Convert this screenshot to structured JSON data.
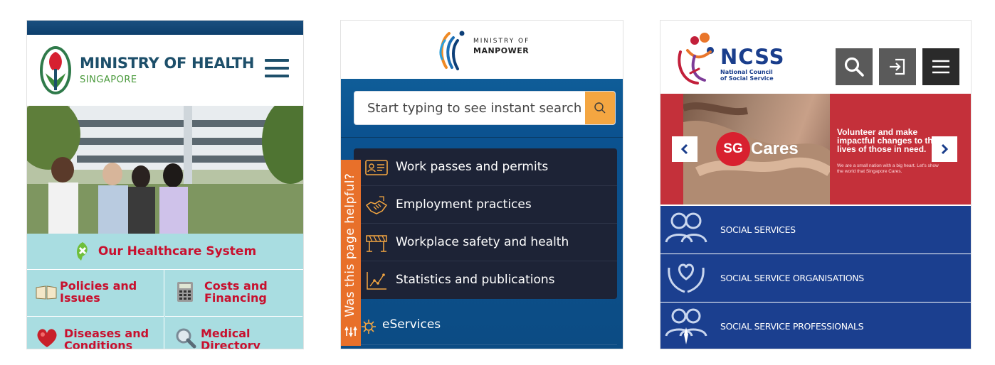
{
  "moh": {
    "title": "MINISTRY OF HEALTH",
    "subtitle": "SINGAPORE",
    "featured_label": "Our Healthcare System",
    "grid": [
      {
        "label1": "Policies and",
        "label2": "Issues",
        "icon": "book-icon"
      },
      {
        "label1": "Costs and",
        "label2": "Financing",
        "icon": "calculator-icon"
      },
      {
        "label1": "Diseases and",
        "label2": "Conditions",
        "icon": "heart-icon"
      },
      {
        "label1": "Medical",
        "label2": "Directory",
        "icon": "magnifier-icon"
      }
    ],
    "colors": {
      "brand": "#1d4f6a",
      "accent": "#c8102e",
      "nav_bg": "#a9dde1"
    }
  },
  "mom": {
    "logo_line1": "MINISTRY OF",
    "logo_line2": "MANPOWER",
    "search_placeholder": "Start typing to see instant search",
    "menu": [
      {
        "label": "Work passes and permits",
        "icon": "id-card-icon"
      },
      {
        "label": "Employment practices",
        "icon": "handshake-icon"
      },
      {
        "label": "Workplace safety and health",
        "icon": "barrier-icon"
      },
      {
        "label": "Statistics and publications",
        "icon": "line-chart-icon"
      }
    ],
    "eservices_label": "eServices",
    "feedback_label": "Was this page helpful?",
    "colors": {
      "header_bg": "#0f5d98",
      "menu_bg": "#1d2336",
      "accent": "#f4a641",
      "feedback": "#e8702a"
    }
  },
  "ncss": {
    "logo_name": "NCSS",
    "logo_full_line1": "National Council",
    "logo_full_line2": "of Social Service",
    "banner": {
      "sg": "SG",
      "cares": "Cares",
      "tagline": "Volunteer and make impactful changes to the lives of those in need.",
      "sub": "We are a small nation with a big heart. Let's show the world that Singapore Cares."
    },
    "items": [
      {
        "label": "SOCIAL SERVICES",
        "icon": "people-icon"
      },
      {
        "label": "SOCIAL SERVICE ORGANISATIONS",
        "icon": "heart-hands-icon"
      },
      {
        "label": "SOCIAL SERVICE PROFESSIONALS",
        "icon": "professionals-icon"
      }
    ],
    "colors": {
      "brand": "#1b3f8f",
      "banner": "#c4303a",
      "button": "#5a5a5a"
    }
  }
}
